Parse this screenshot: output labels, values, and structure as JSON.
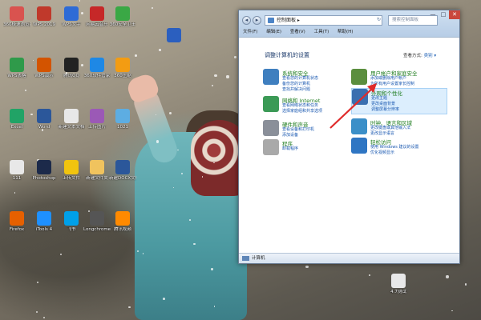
{
  "window": {
    "address": "控制面板 ▸",
    "search_placeholder": "搜索控制面板",
    "menu": [
      "文件(F)",
      "编辑(E)",
      "查看(V)",
      "工具(T)",
      "帮助(H)"
    ],
    "heading": "调整计算机的设置",
    "view_by_label": "查看方式:",
    "view_by_value": "类别 ▾",
    "status_bar": "计算机",
    "controls": [
      "—",
      "□",
      "✕"
    ]
  },
  "categories": [
    {
      "id": "system",
      "title": "系统和安全",
      "color": "#3f7fbf",
      "links": [
        "查看您的计算机状态",
        "备份您的计算机",
        "查找并解决问题"
      ]
    },
    {
      "id": "network",
      "title": "网络和 Internet",
      "color": "#3b9a56",
      "links": [
        "查看网络状态和任务",
        "选择家庭组和共享选项"
      ]
    },
    {
      "id": "hardware",
      "title": "硬件和声音",
      "color": "#8a8f99",
      "links": [
        "查看设备和打印机",
        "添加设备"
      ]
    },
    {
      "id": "programs",
      "title": "程序",
      "color": "#a9a9a9",
      "links": [
        "卸载程序"
      ]
    },
    {
      "id": "accounts",
      "title": "用户帐户和家庭安全",
      "color": "#5b8e3e",
      "links": [
        "添加或删除用户帐户",
        "为所有用户设置家长控制"
      ]
    },
    {
      "id": "appearance",
      "title": "外观和个性化",
      "color": "#3a6fb0",
      "links": [
        "更改主题",
        "更改桌面背景",
        "调整屏幕分辨率"
      ]
    },
    {
      "id": "clock",
      "title": "时钟、语言和区域",
      "color": "#3b8fc8",
      "links": [
        "更改键盘或其他输入法",
        "更改显示语言"
      ]
    },
    {
      "id": "ease",
      "title": "轻松访问",
      "color": "#2f76c3",
      "links": [
        "使用 Windows 建议的设置",
        "优化视频显示"
      ]
    }
  ],
  "desktop_icons": [
    {
      "label": "360极速浏览器",
      "color": "#d9534f"
    },
    {
      "label": "WPS 2019",
      "color": "#c0392b"
    },
    {
      "label": "WPS文字",
      "color": "#2e6bd6"
    },
    {
      "label": "网易云音乐",
      "color": "#c62828"
    },
    {
      "label": "360安全卫士",
      "color": "#3aa845"
    },
    {
      "label": "WPS表格",
      "color": "#2f9a4a"
    },
    {
      "label": "WPS演示",
      "color": "#d35400"
    },
    {
      "label": "腾讯QQ",
      "color": "#222"
    },
    {
      "label": "360软件管家",
      "color": "#1e88e5"
    },
    {
      "label": "360压缩",
      "color": "#f39c12"
    },
    {
      "label": "Excel",
      "color": "#21a366"
    },
    {
      "label": "Word",
      "color": "#2b579a"
    },
    {
      "label": "新建文本文档",
      "color": "#e8e8e8"
    },
    {
      "label": "上传图片",
      "color": "#9b59b6"
    },
    {
      "label": "1021",
      "color": "#5dade2"
    },
    {
      "label": "111",
      "color": "#e8e8e8"
    },
    {
      "label": "Photoshop",
      "color": "#1c2a4a"
    },
    {
      "label": "上传文件",
      "color": "#f1c40f"
    },
    {
      "label": "新建文件夹",
      "color": "#f0c35e"
    },
    {
      "label": "新建DOCX文档",
      "color": "#2b579a"
    },
    {
      "label": "Firefox",
      "color": "#e66000"
    },
    {
      "label": "iTools 4",
      "color": "#1e90ff"
    },
    {
      "label": "飞书",
      "color": "#00a0e9"
    },
    {
      "label": "Longchromew",
      "color": "#555"
    },
    {
      "label": "腾讯视频",
      "color": "#ff8a00"
    }
  ],
  "misc_desktop_label": "4.7测试"
}
